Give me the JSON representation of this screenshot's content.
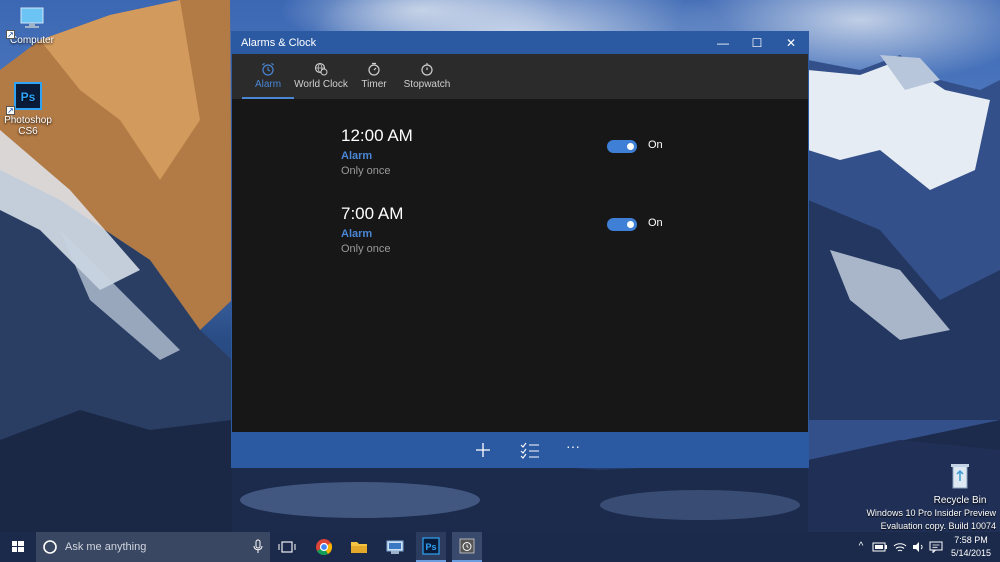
{
  "desktop": {
    "icons": [
      {
        "label": "Computer"
      },
      {
        "label": "Photoshop CS6"
      },
      {
        "label": "Recycle Bin"
      }
    ],
    "watermark": {
      "line1": "Windows 10 Pro Insider Preview",
      "line2": "Evaluation copy. Build 10074"
    }
  },
  "window": {
    "title": "Alarms & Clock",
    "controls": {
      "minimize": "—",
      "maximize": "☐",
      "close": "✕"
    }
  },
  "tabs": [
    {
      "label": "Alarm",
      "icon": "alarm-clock-icon",
      "active": true
    },
    {
      "label": "World Clock",
      "icon": "globe-clock-icon",
      "active": false
    },
    {
      "label": "Timer",
      "icon": "timer-icon",
      "active": false
    },
    {
      "label": "Stopwatch",
      "icon": "stopwatch-icon",
      "active": false
    }
  ],
  "alarms": [
    {
      "time": "12:00 AM",
      "name": "Alarm",
      "repeat": "Only once",
      "enabled": true,
      "state_label": "On"
    },
    {
      "time": "7:00 AM",
      "name": "Alarm",
      "repeat": "Only once",
      "enabled": true,
      "state_label": "On"
    }
  ],
  "commandbar": {
    "buttons": [
      "add-icon",
      "select-list-icon",
      "more-icon"
    ],
    "more_glyph": "···"
  },
  "taskbar": {
    "search_placeholder": "Ask me anything",
    "apps": [
      "task-view-icon",
      "chrome-icon",
      "file-explorer-icon",
      "network-app-icon",
      "photoshop-icon",
      "alarms-app-icon"
    ],
    "photoshop_glyph": "Ps",
    "tray_arrow": "^",
    "clock_time": "7:58 PM",
    "clock_date": "5/14/2015"
  },
  "colors": {
    "accent": "#2b5aa3",
    "accent_text": "#4a86d4",
    "window_bg": "#171717",
    "tab_bar": "#2b2b2b",
    "taskbar": "#1b2a4a"
  }
}
